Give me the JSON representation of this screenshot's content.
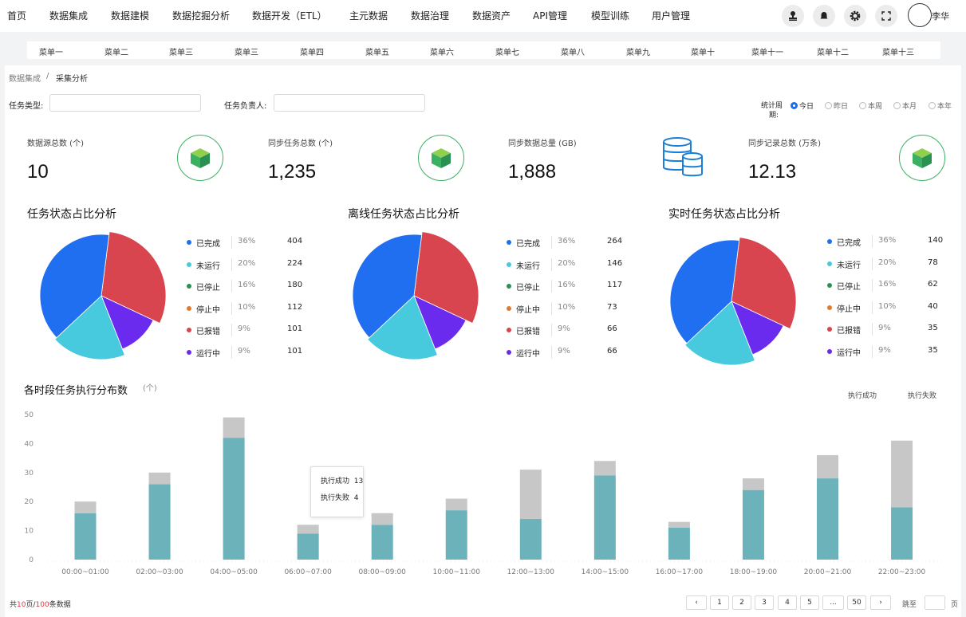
{
  "topnav": {
    "items": [
      "首页",
      "数据集成",
      "数据建模",
      "数据挖掘分析",
      "数据开发（ETL）",
      "主元数据",
      "数据治理",
      "数据资产",
      "API管理",
      "模型训练",
      "用户管理"
    ],
    "user": "李华"
  },
  "submenu": [
    "菜单一",
    "菜单二",
    "菜单三",
    "菜单三",
    "菜单四",
    "菜单五",
    "菜单六",
    "菜单七",
    "菜单八",
    "菜单九",
    "菜单十",
    "菜单十一",
    "菜单十二",
    "菜单十三"
  ],
  "breadcrumb": {
    "parent": "数据集成",
    "separator": "/",
    "current": "采集分析"
  },
  "filters": {
    "task_type_label": "任务类型:",
    "task_owner_label": "任务负责人:",
    "task_type_value": "",
    "task_owner_value": ""
  },
  "period": {
    "label_line1": "统计周",
    "label_line2": "期:",
    "options": [
      "今日",
      "昨日",
      "本周",
      "本月",
      "本年"
    ],
    "selected": 0
  },
  "stats": [
    {
      "label": "数据源总数 (个)",
      "value": "10",
      "icon": "cube-icon"
    },
    {
      "label": "同步任务总数 (个)",
      "value": "1,235",
      "icon": "cube-icon"
    },
    {
      "label": "同步数据总量 (GB)",
      "value": "1,888",
      "icon": "database-icon"
    },
    {
      "label": "同步记录总数 (万条)",
      "value": "12.13",
      "icon": "cube-icon"
    }
  ],
  "colors": {
    "accent": "#1b6fe6",
    "green": "#3bb062",
    "completed": "#1f6ff0",
    "not_running": "#47c9de",
    "stopped": "#2a9152",
    "stopping": "#e07a2f",
    "error": "#d8454f",
    "running": "#6a2bef",
    "bar_success": "#6bb2bb",
    "bar_fail": "#c7c7c7",
    "page_red": "#e0383e"
  },
  "legend_labels": [
    "已完成",
    "未运行",
    "已停止",
    "停止中",
    "已报错",
    "运行中"
  ],
  "chart_data": [
    {
      "type": "pie",
      "title": "任务状态占比分析",
      "labels": [
        "已完成",
        "未运行",
        "已停止",
        "停止中",
        "已报错",
        "运行中"
      ],
      "percents": [
        "36%",
        "20%",
        "16%",
        "10%",
        "9%",
        "9%"
      ],
      "values": [
        404,
        224,
        180,
        112,
        101,
        101
      ],
      "legend_display": [
        "已完成",
        "未运行",
        "已停止",
        "停止中",
        "已报错",
        "运行中"
      ]
    },
    {
      "type": "pie",
      "title": "离线任务状态占比分析",
      "labels": [
        "已完成",
        "未运行",
        "已停止",
        "停止中",
        "已报错",
        "运行中"
      ],
      "percents": [
        "36%",
        "20%",
        "16%",
        "10%",
        "9%",
        "9%"
      ],
      "values": [
        264,
        146,
        117,
        73,
        66,
        66
      ],
      "legend_display": [
        "已完成",
        "未运行",
        "已停止",
        "停止中",
        "已报错",
        "运行中"
      ]
    },
    {
      "type": "pie",
      "title": "实时任务状态占比分析",
      "labels": [
        "已完成",
        "未运行",
        "已停止",
        "停止中",
        "已报错",
        "运行中"
      ],
      "percents": [
        "36%",
        "20%",
        "16%",
        "10%",
        "9%",
        "9%"
      ],
      "values": [
        140,
        78,
        62,
        40,
        35,
        35
      ],
      "legend_display": [
        "已完成",
        "未运行",
        "已停止",
        "停止中",
        "已报错",
        "运行中"
      ]
    },
    {
      "type": "bar",
      "title": "各时段任务执行分布数",
      "unit": "(个)",
      "stacked": true,
      "categories": [
        "00:00~01:00",
        "02:00~03:00",
        "04:00~05:00",
        "06:00~07:00",
        "08:00~09:00",
        "10:00~11:00",
        "12:00~13:00",
        "14:00~15:00",
        "16:00~17:00",
        "18:00~19:00",
        "20:00~21:00",
        "22:00~23:00"
      ],
      "series": [
        {
          "name": "执行成功",
          "values": [
            16,
            26,
            42,
            9,
            12,
            17,
            14,
            29,
            11,
            24,
            28,
            18
          ]
        },
        {
          "name": "执行失败",
          "values": [
            4,
            4,
            7,
            3,
            4,
            4,
            17,
            5,
            2,
            4,
            8,
            23
          ]
        }
      ],
      "ylim": [
        0,
        50
      ],
      "yticks": [
        0,
        10,
        20,
        30,
        40,
        50
      ],
      "tooltip": {
        "category_index": 3,
        "rows": [
          {
            "name": "执行成功",
            "value": "13"
          },
          {
            "name": "执行失败",
            "value": "4"
          }
        ]
      }
    }
  ],
  "pagination": {
    "total_prefix": "共",
    "total_pages": "10",
    "total_mid": "页/",
    "total_items": "100",
    "total_suffix": "条数据",
    "prev": "‹",
    "next": "›",
    "pages": [
      "1",
      "2",
      "3",
      "4",
      "5",
      "...",
      "50"
    ],
    "jump_label": "跳至",
    "page_unit": "页"
  }
}
